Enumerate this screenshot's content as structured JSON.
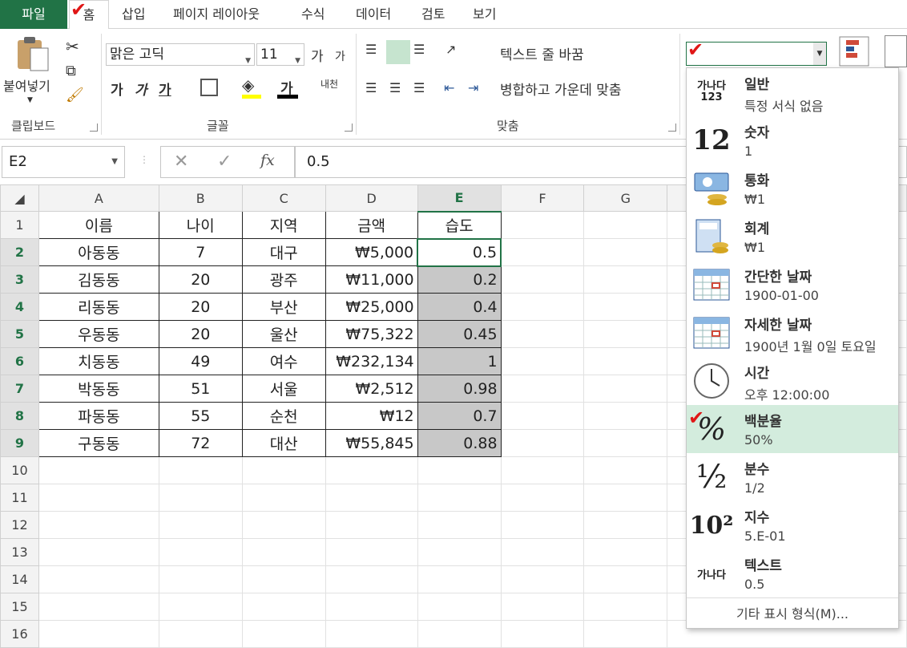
{
  "tabs": {
    "file": "파일",
    "home": "홈",
    "items": [
      "삽입",
      "페이지 레이아웃",
      "수식",
      "데이터",
      "검토",
      "보기"
    ]
  },
  "ribbon": {
    "clipboard": {
      "paste": "붙여넣기",
      "label": "클립보드"
    },
    "font": {
      "name": "맑은 고딕",
      "size": "11",
      "grow": "가",
      "shrink": "가",
      "bold": "가",
      "italic": "가",
      "underline": "가",
      "fontcolor": "가",
      "phonetic": "내천",
      "label": "글꼴"
    },
    "align": {
      "wrap": "텍스트 줄 바꿈",
      "merge": "병합하고 가운데 맞춤",
      "label": "맞춤"
    }
  },
  "formula_bar": {
    "namebox": "E2",
    "value": "0.5",
    "fx": "fx"
  },
  "columns": [
    "A",
    "B",
    "C",
    "D",
    "E",
    "F",
    "G"
  ],
  "rows": [
    "1",
    "2",
    "3",
    "4",
    "5",
    "6",
    "7",
    "8",
    "9",
    "10",
    "11",
    "12",
    "13",
    "14",
    "15",
    "16"
  ],
  "header_row": [
    "이름",
    "나이",
    "지역",
    "금액",
    "습도"
  ],
  "data_rows": [
    [
      "아동동",
      "7",
      "대구",
      "₩5,000",
      "0.5"
    ],
    [
      "김동동",
      "20",
      "광주",
      "₩11,000",
      "0.2"
    ],
    [
      "리동동",
      "20",
      "부산",
      "₩25,000",
      "0.4"
    ],
    [
      "우동동",
      "20",
      "울산",
      "₩75,322",
      "0.45"
    ],
    [
      "치동동",
      "49",
      "여수",
      "₩232,134",
      "1"
    ],
    [
      "박동동",
      "51",
      "서울",
      "₩2,512",
      "0.98"
    ],
    [
      "파동동",
      "55",
      "순천",
      "₩12",
      "0.7"
    ],
    [
      "구동동",
      "72",
      "대산",
      "₩55,845",
      "0.88"
    ]
  ],
  "format_menu": {
    "items": [
      {
        "name": "일반",
        "sample": "특정 서식 없음",
        "icon": "general-icon",
        "icon_text": "가나다 123"
      },
      {
        "name": "숫자",
        "sample": "1",
        "icon": "number-icon",
        "icon_text": "12"
      },
      {
        "name": "통화",
        "sample": "₩1",
        "icon": "currency-icon"
      },
      {
        "name": "회계",
        "sample": "₩1",
        "icon": "accounting-icon"
      },
      {
        "name": "간단한 날짜",
        "sample": "1900-01-00",
        "icon": "calendar-icon"
      },
      {
        "name": "자세한 날짜",
        "sample": "1900년 1월 0일 토요일",
        "icon": "calendar-icon"
      },
      {
        "name": "시간",
        "sample": "오후 12:00:00",
        "icon": "clock-icon"
      },
      {
        "name": "백분율",
        "sample": "50%",
        "icon": "percent-icon",
        "icon_text": "%"
      },
      {
        "name": "분수",
        "sample": "1/2",
        "icon": "fraction-icon",
        "icon_text": "½"
      },
      {
        "name": "지수",
        "sample": "5.E-01",
        "icon": "scientific-icon",
        "icon_text": "10²"
      },
      {
        "name": "텍스트",
        "sample": "0.5",
        "icon": "text-icon",
        "icon_text": "가나다"
      }
    ],
    "more": "기타 표시 형식(M)...",
    "highlighted_index": 7
  },
  "colors": {
    "accent": "#217346",
    "highlight": "#d3ecdd",
    "selection_shade": "#c8c8c8",
    "check": "#e01616"
  }
}
